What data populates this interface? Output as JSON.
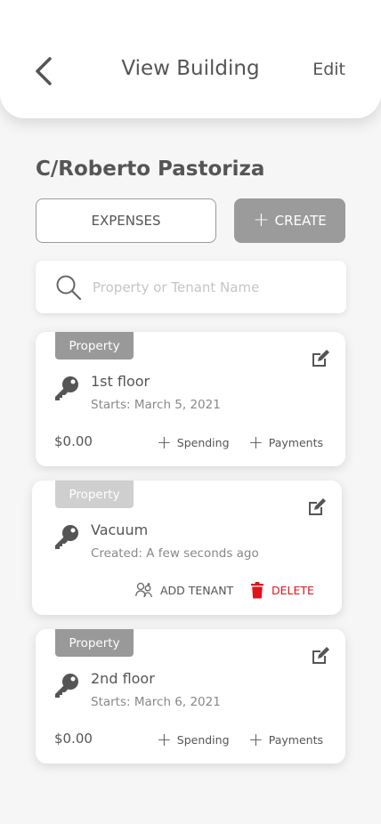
{
  "header": {
    "title": "View Building",
    "edit_label": "Edit"
  },
  "building": {
    "name": "C/Roberto Pastoriza"
  },
  "buttons": {
    "expenses": "EXPENSES",
    "create": "CREATE"
  },
  "search": {
    "placeholder": "Property or Tenant Name"
  },
  "cards": [
    {
      "tag": "Property",
      "name": "1st floor",
      "subtitle": "Starts: March 5, 2021",
      "amount": "$0.00",
      "spending_label": "Spending",
      "payments_label": "Payments"
    },
    {
      "tag": "Property",
      "name": "Vacuum",
      "subtitle": "Created: A few seconds ago",
      "add_tenant_label": "ADD TENANT",
      "delete_label": "DELETE"
    },
    {
      "tag": "Property",
      "name": "2nd floor",
      "subtitle": "Starts: March 6, 2021",
      "amount": "$0.00",
      "spending_label": "Spending",
      "payments_label": "Payments"
    }
  ],
  "colors": {
    "accent_gray": "#9b9b9b",
    "delete_red": "#e0141b",
    "background": "#f6f6f6"
  },
  "icons": [
    "back-arrow-icon",
    "search-icon",
    "edit-icon",
    "key-icon",
    "plus-icon",
    "add-tenant-icon",
    "trash-icon"
  ]
}
